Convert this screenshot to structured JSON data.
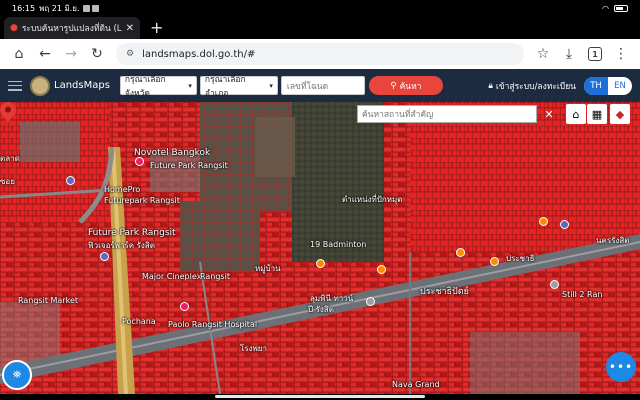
{
  "status": {
    "time": "16:15",
    "date": "พฤ 21 มิ.ย.",
    "battery": ""
  },
  "tab": {
    "title": "ระบบค้นหารูปแปลงที่ดิน (Lands",
    "close": "✕"
  },
  "browser": {
    "url": "landsmaps.dol.go.th/#",
    "tab_count": "1"
  },
  "header": {
    "brand": "LandsMaps",
    "province_placeholder": "กรุณาเลือกจังหวัด",
    "district_placeholder": "กรุณาเลือกอำเภอ",
    "deed_placeholder": "เลขที่โฉนด",
    "search_label": "ค้นหา",
    "login_label": "เข้าสู่ระบบ/ลงทะเบียน",
    "lang_th": "TH",
    "lang_en": "EN"
  },
  "map": {
    "search_placeholder": "ค้นหาสถานที่สำคัญ",
    "labels": {
      "novotel": "Novotel Bangkok",
      "future_park_rangsit": "Future Park Rangsit",
      "homepro": "HomePro",
      "futurepark": "Futurepark Rangsit",
      "future_park_rangsit_2": "Future Park Rangsit",
      "future_park_th": "ฟิวเจอร์พาร์ค รังสิต",
      "major": "Major Cineplex",
      "rangsit": "Rangsit",
      "rangsit_market": "Rangsit Market",
      "pochana": "Pochana",
      "paolo": "Paolo Rangsit Hospital",
      "badminton": "19 Badminton",
      "village": "หมู่บ้าน",
      "subdistrict": "ตำแหน่งที่ปักหมุด",
      "summit": "ลุมพินี ทาวน์",
      "rangsit_th": "ปี รังสิต",
      "prachathipat": "ประชาธิปัตย์",
      "nava": "Nava Grand",
      "still": "Still 2 Ran",
      "nakhon": "นครรังสิต",
      "market_th": "ตลาด",
      "pi": "ประชาธิ",
      "sub": "ซอย",
      "khlong": "โรงพยา"
    }
  }
}
